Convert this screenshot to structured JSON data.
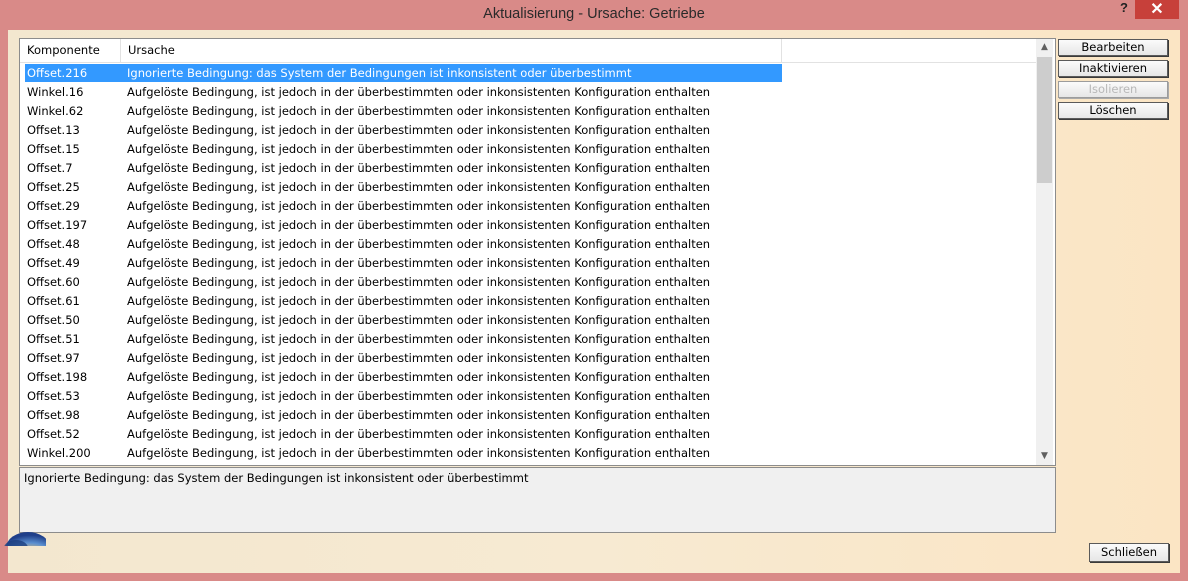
{
  "window": {
    "title": "Aktualisierung - Ursache: Getriebe",
    "help_glyph": "?",
    "close_glyph": "✕"
  },
  "list": {
    "columns": [
      "Komponente",
      "Ursache"
    ],
    "rows": [
      {
        "component": "Offset.216",
        "cause": "Ignorierte Bedingung: das System der Bedingungen ist inkonsistent oder überbestimmt",
        "selected": true
      },
      {
        "component": "Winkel.16",
        "cause": "Aufgelöste Bedingung, ist jedoch in der überbestimmten oder inkonsistenten Konfiguration enthalten"
      },
      {
        "component": "Winkel.62",
        "cause": "Aufgelöste Bedingung, ist jedoch in der überbestimmten oder inkonsistenten Konfiguration enthalten"
      },
      {
        "component": "Offset.13",
        "cause": "Aufgelöste Bedingung, ist jedoch in der überbestimmten oder inkonsistenten Konfiguration enthalten"
      },
      {
        "component": "Offset.15",
        "cause": "Aufgelöste Bedingung, ist jedoch in der überbestimmten oder inkonsistenten Konfiguration enthalten"
      },
      {
        "component": "Offset.7",
        "cause": "Aufgelöste Bedingung, ist jedoch in der überbestimmten oder inkonsistenten Konfiguration enthalten"
      },
      {
        "component": "Offset.25",
        "cause": "Aufgelöste Bedingung, ist jedoch in der überbestimmten oder inkonsistenten Konfiguration enthalten"
      },
      {
        "component": "Offset.29",
        "cause": "Aufgelöste Bedingung, ist jedoch in der überbestimmten oder inkonsistenten Konfiguration enthalten"
      },
      {
        "component": "Offset.197",
        "cause": "Aufgelöste Bedingung, ist jedoch in der überbestimmten oder inkonsistenten Konfiguration enthalten"
      },
      {
        "component": "Offset.48",
        "cause": "Aufgelöste Bedingung, ist jedoch in der überbestimmten oder inkonsistenten Konfiguration enthalten"
      },
      {
        "component": "Offset.49",
        "cause": "Aufgelöste Bedingung, ist jedoch in der überbestimmten oder inkonsistenten Konfiguration enthalten"
      },
      {
        "component": "Offset.60",
        "cause": "Aufgelöste Bedingung, ist jedoch in der überbestimmten oder inkonsistenten Konfiguration enthalten"
      },
      {
        "component": "Offset.61",
        "cause": "Aufgelöste Bedingung, ist jedoch in der überbestimmten oder inkonsistenten Konfiguration enthalten"
      },
      {
        "component": "Offset.50",
        "cause": "Aufgelöste Bedingung, ist jedoch in der überbestimmten oder inkonsistenten Konfiguration enthalten"
      },
      {
        "component": "Offset.51",
        "cause": "Aufgelöste Bedingung, ist jedoch in der überbestimmten oder inkonsistenten Konfiguration enthalten"
      },
      {
        "component": "Offset.97",
        "cause": "Aufgelöste Bedingung, ist jedoch in der überbestimmten oder inkonsistenten Konfiguration enthalten"
      },
      {
        "component": "Offset.198",
        "cause": "Aufgelöste Bedingung, ist jedoch in der überbestimmten oder inkonsistenten Konfiguration enthalten"
      },
      {
        "component": "Offset.53",
        "cause": "Aufgelöste Bedingung, ist jedoch in der überbestimmten oder inkonsistenten Konfiguration enthalten"
      },
      {
        "component": "Offset.98",
        "cause": "Aufgelöste Bedingung, ist jedoch in der überbestimmten oder inkonsistenten Konfiguration enthalten"
      },
      {
        "component": "Offset.52",
        "cause": "Aufgelöste Bedingung, ist jedoch in der überbestimmten oder inkonsistenten Konfiguration enthalten"
      },
      {
        "component": "Winkel.200",
        "cause": "Aufgelöste Bedingung, ist jedoch in der überbestimmten oder inkonsistenten Konfiguration enthalten"
      }
    ]
  },
  "detail": {
    "text": "Ignorierte Bedingung: das System der Bedingungen ist inkonsistent oder überbestimmt"
  },
  "buttons": {
    "edit": "Bearbeiten",
    "deactivate": "Inaktivieren",
    "isolate": "Isolieren",
    "delete": "Löschen",
    "close": "Schließen"
  },
  "icons": {
    "scroll_up": "chevron-up-icon",
    "scroll_down": "chevron-down-icon",
    "corner": "app-logo-icon"
  },
  "colors": {
    "title_bar": "#d98a88",
    "close_button": "#c7403a",
    "selection": "#3399ff",
    "client_background": "#f7ead2"
  }
}
